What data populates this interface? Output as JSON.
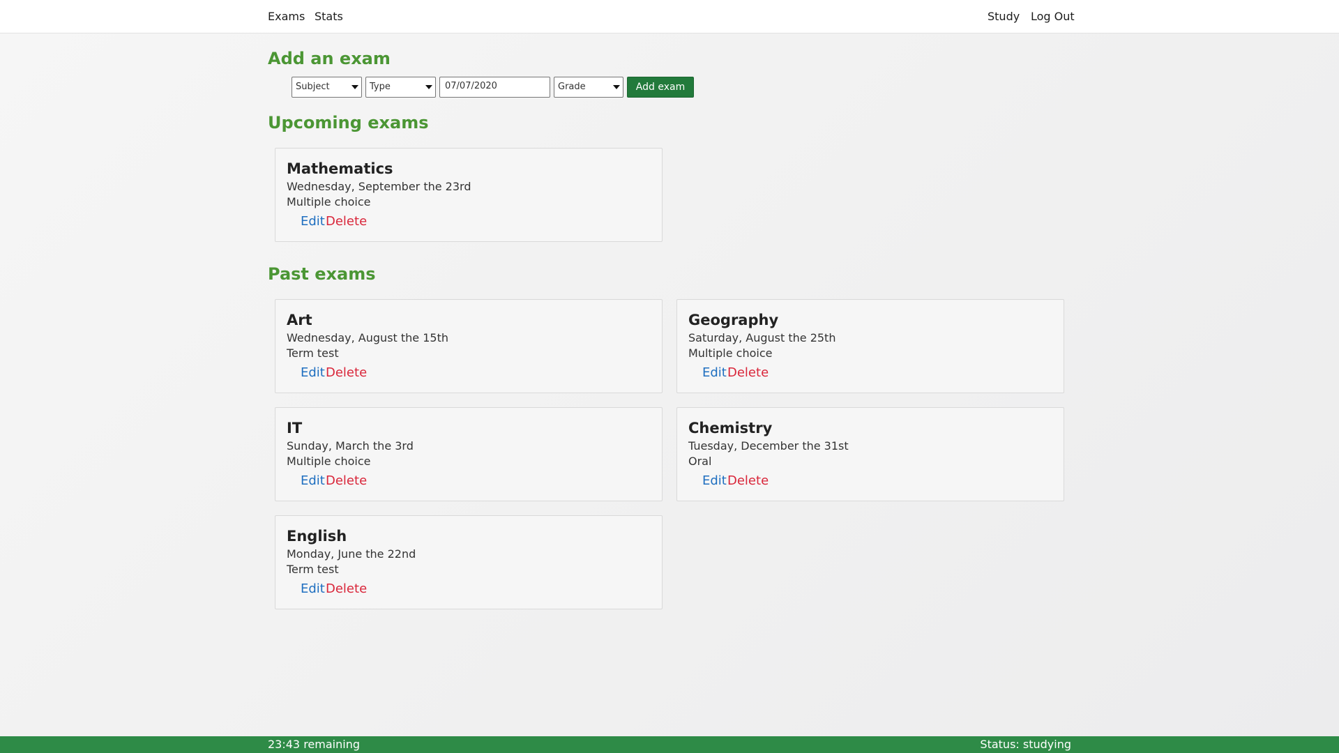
{
  "nav": {
    "exams": "Exams",
    "stats": "Stats",
    "study": "Study",
    "logout": "Log Out"
  },
  "add_exam": {
    "title": "Add an exam",
    "subject_select": "Subject",
    "type_select": "Type",
    "date_value": "07/07/2020",
    "grade_select": "Grade",
    "button": "Add exam"
  },
  "upcoming": {
    "title": "Upcoming exams",
    "exams": [
      {
        "subject": "Mathematics",
        "date": "Wednesday, September the 23rd",
        "type": "Multiple choice",
        "edit": "Edit",
        "delete": "Delete"
      }
    ]
  },
  "past": {
    "title": "Past exams",
    "exams": [
      {
        "subject": "Art",
        "date": "Wednesday, August the 15th",
        "type": "Term test",
        "edit": "Edit",
        "delete": "Delete"
      },
      {
        "subject": "Geography",
        "date": "Saturday, August the 25th",
        "type": "Multiple choice",
        "edit": "Edit",
        "delete": "Delete"
      },
      {
        "subject": "IT",
        "date": "Sunday, March the 3rd",
        "type": "Multiple choice",
        "edit": "Edit",
        "delete": "Delete"
      },
      {
        "subject": "Chemistry",
        "date": "Tuesday, December the 31st",
        "type": "Oral",
        "edit": "Edit",
        "delete": "Delete"
      },
      {
        "subject": "English",
        "date": "Monday, June the 22nd",
        "type": "Term test",
        "edit": "Edit",
        "delete": "Delete"
      }
    ]
  },
  "statusbar": {
    "timer": "23:43 remaining",
    "status": "Status: studying"
  },
  "colors": {
    "heading_green": "#4b9634",
    "button_green": "#227a3b",
    "statusbar_green": "#2e8b47",
    "edit_blue": "#1f6fc0",
    "delete_red": "#d9263a"
  }
}
